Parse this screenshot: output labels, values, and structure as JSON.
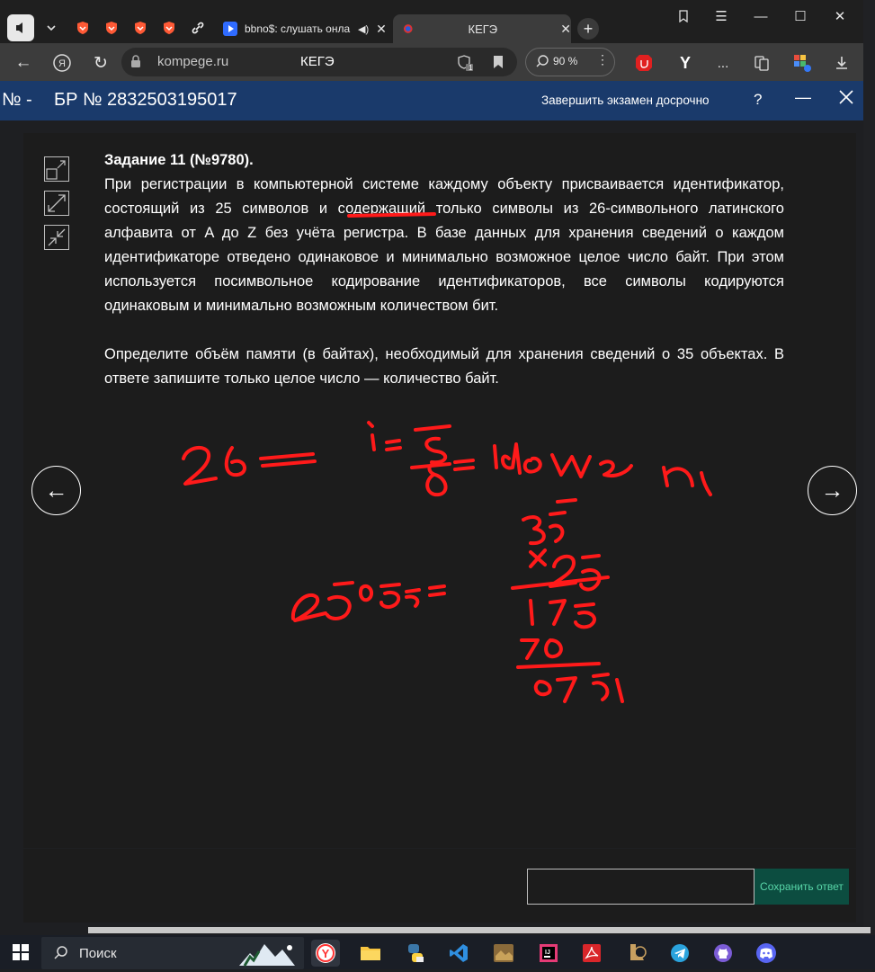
{
  "browser": {
    "tabs": [
      {
        "title": "bbno$: слушать онла",
        "has_audio": true
      },
      {
        "title": "КЕГЭ",
        "active": true
      }
    ],
    "url": "kompege.ru",
    "page_title": "КЕГЭ",
    "zoom": "90 %",
    "shield_badge": "1",
    "extension_letter": "Y",
    "more_label": "..."
  },
  "exam": {
    "title_prefix": "№ -",
    "title": "БР № 2832503195017",
    "finish_label": "Завершить экзамен досрочно",
    "help_label": "?"
  },
  "task": {
    "title": "Задание 11 (№9780).",
    "paragraph1": "При регистрации в компьютерной системе каждому объекту присваивается идентификатор, состоящий из 25 символов и содержащий только символы из 26-символьного латинского алфавита от A до Z без учёта регистра. В базе данных для хранения сведений о каждом идентификаторе отведено одинаковое и минимально возможное целое число байт. При этом используется посимвольное кодирование идентификаторов, все символы кодируются одинаковым и минимально возможным количеством бит.",
    "paragraph2": "Определите объём памяти (в байтах), необходимый для хранения сведений о 35 объектах. В ответе запишите только целое число — количество байт."
  },
  "navigation": {
    "prev": "←",
    "next": "→"
  },
  "answer": {
    "value": "",
    "save_label": "Сохранить ответ"
  },
  "taskbar": {
    "search_label": "Поиск"
  },
  "colors": {
    "header": "#1a3a6b",
    "save_bg": "#0c4d40",
    "save_text": "#58d6a8",
    "ink": "#ff1a1a"
  },
  "icons": {
    "tool1": "fit-screen-icon",
    "tool2": "expand-icon",
    "tool3": "shrink-icon"
  }
}
